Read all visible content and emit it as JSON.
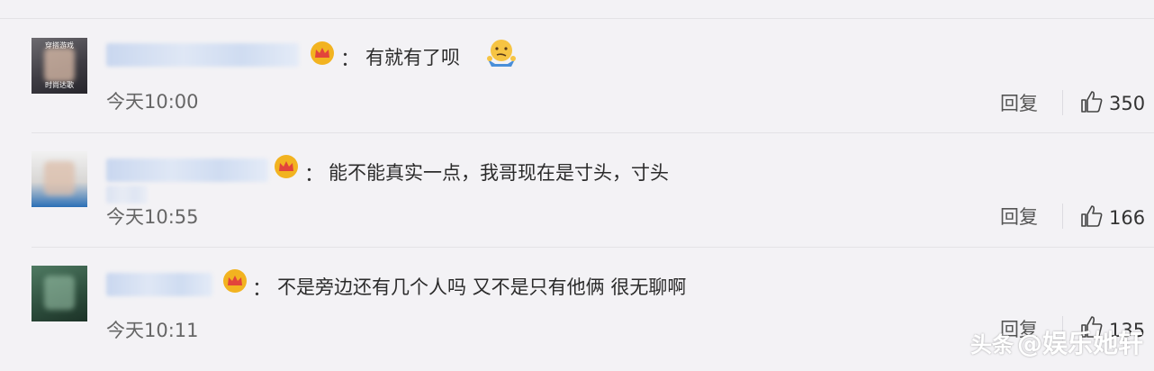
{
  "comments": [
    {
      "avatar_text_top": "穿搭游戏",
      "avatar_text_bottom": "时尚达歌",
      "text": "有就有了呗",
      "emoji_icon": "shrug-face-icon",
      "time": "今天10:00",
      "reply_label": "回复",
      "likes": "350"
    },
    {
      "text": "能不能真实一点，我哥现在是寸头，寸头",
      "time": "今天10:55",
      "reply_label": "回复",
      "likes": "166"
    },
    {
      "text": "不是旁边还有几个人吗 又不是只有他俩 很无聊啊",
      "time": "今天10:11",
      "reply_label": "回复",
      "likes": "135"
    }
  ],
  "colon": "：",
  "watermark": {
    "logo": "头条",
    "handle": "@娱乐她轩"
  },
  "colors": {
    "background": "#f3f2f5",
    "crown_gold": "#f2b320",
    "crown_red": "#e2443b",
    "name_blur": "#cfdcf1"
  },
  "icons": [
    "crown-badge-icon",
    "thumbs-up-icon",
    "shrug-face-icon"
  ]
}
